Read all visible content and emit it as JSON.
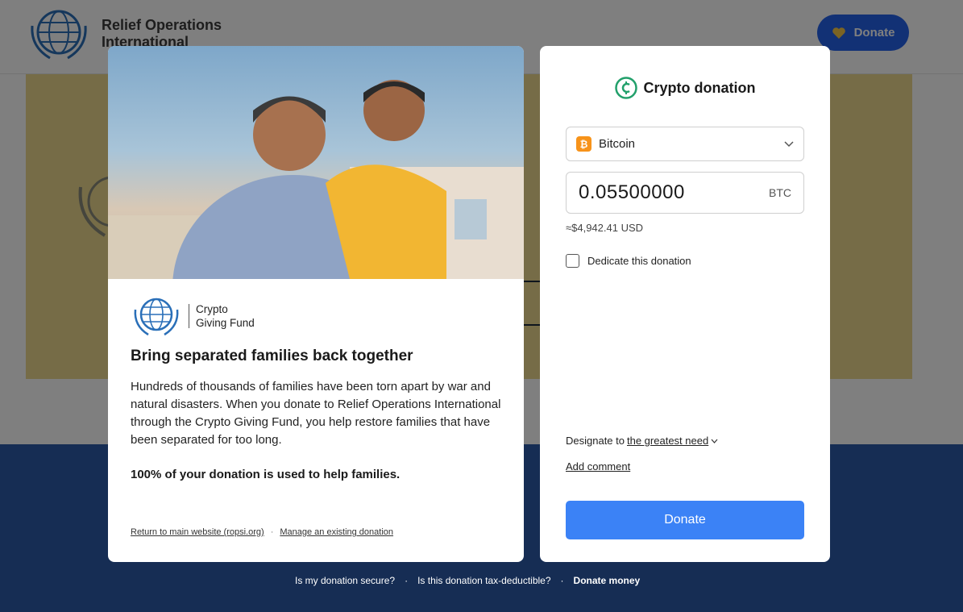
{
  "site": {
    "logo_line1": "Relief Operations",
    "logo_line2": "International",
    "header_donate_label": "Donate"
  },
  "modal_left": {
    "brand_line1": "Crypto",
    "brand_line2": "Giving Fund",
    "title": "Bring separated families back together",
    "body": "Hundreds of thousands of families have been torn apart by war and natural disasters. When you donate to Relief Operations International through the Crypto Giving Fund, you help restore families that have been separated for too long.",
    "emphasis": "100% of your donation is used to help families.",
    "link_return": "Return to main website (ropsi.org)",
    "link_separator": "·",
    "link_manage": "Manage an existing donation"
  },
  "modal_right": {
    "title": "Crypto donation",
    "currency": {
      "selected": "Bitcoin",
      "badge": "₿"
    },
    "amount": {
      "value": "0.05500000",
      "unit": "BTC"
    },
    "usd_equivalent": "≈$4,942.41 USD",
    "dedicate_label": "Dedicate this donation",
    "dedicate_checked": false,
    "designate_prefix": "Designate to",
    "designate_value": "the greatest need",
    "add_comment": "Add comment",
    "donate_label": "Donate"
  },
  "footer": {
    "secure": "Is my donation secure?",
    "sep1": "·",
    "tax": "Is this donation tax-deductible?",
    "sep2": "·",
    "donate_money": "Donate money"
  },
  "colors": {
    "primary_button": "#3b82f6",
    "header_button": "#2563eb",
    "crypto_icon": "#22a06b",
    "bitcoin": "#f7931a",
    "hero_bg": "#ecd98e",
    "band_bg": "#2c5aa8"
  }
}
